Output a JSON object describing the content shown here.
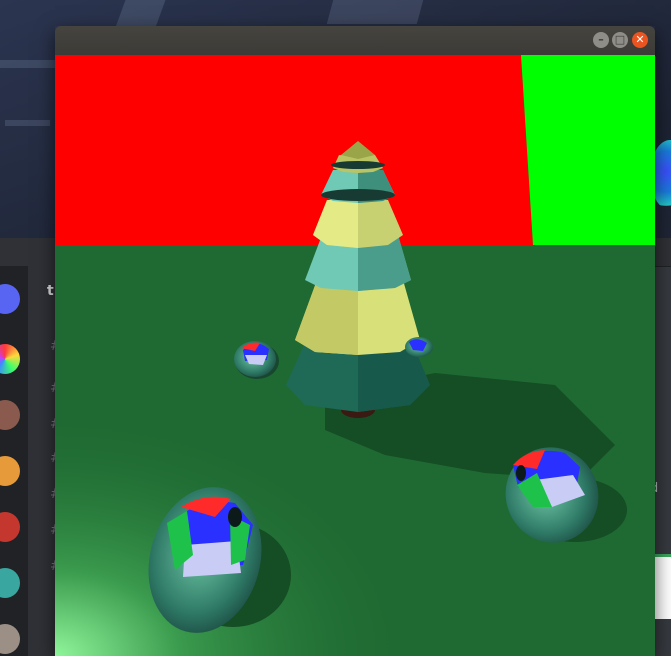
{
  "window": {
    "title": "",
    "buttons": {
      "minimize_glyph": "–",
      "maximize_glyph": "□",
      "close_glyph": "✕"
    }
  },
  "scene": {
    "wall_left_color": "#ff0000",
    "wall_right_color": "#00ff00",
    "floor_color": "#1f6a32",
    "objects": [
      "pine-tree",
      "mirror-sphere",
      "mirror-sphere",
      "mirror-sphere",
      "mirror-sphere"
    ]
  },
  "background_app": {
    "channel_letter": "t",
    "right_edge_letter": "d",
    "rail_icons": [
      "server-icon",
      "server-icon",
      "server-icon",
      "server-icon",
      "server-icon",
      "server-icon",
      "server-icon"
    ]
  }
}
